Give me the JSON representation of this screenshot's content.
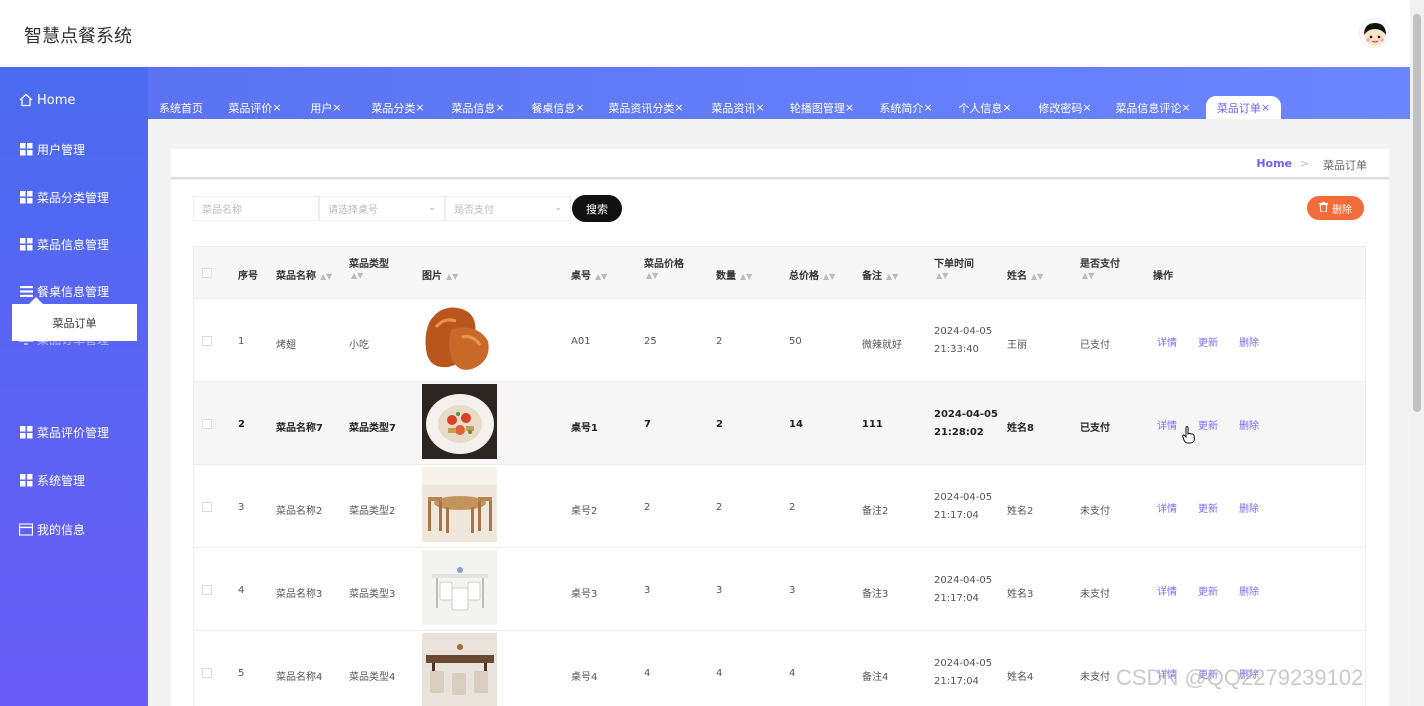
{
  "app": {
    "title": "智慧点餐系统"
  },
  "sidebar": {
    "items": [
      {
        "label": "Home",
        "icon": "home-icon"
      },
      {
        "label": "用户管理",
        "icon": "grid-icon"
      },
      {
        "label": "菜品分类管理",
        "icon": "grid-icon"
      },
      {
        "label": "菜品信息管理",
        "icon": "grid-icon"
      },
      {
        "label": "餐桌信息管理",
        "icon": "list-icon"
      },
      {
        "label": "菜品订单管理",
        "icon": "monitor-icon"
      },
      {
        "label": "菜品评价管理",
        "icon": "grid-icon"
      },
      {
        "label": "系统管理",
        "icon": "grid-icon"
      },
      {
        "label": "我的信息",
        "icon": "card-icon"
      }
    ],
    "sub_item": "菜品订单"
  },
  "tabs": [
    {
      "label": "系统首页",
      "close": ""
    },
    {
      "label": "菜品评价",
      "close": "×"
    },
    {
      "label": "用户",
      "close": "×"
    },
    {
      "label": "菜品分类",
      "close": "×"
    },
    {
      "label": "菜品信息",
      "close": "×"
    },
    {
      "label": "餐桌信息",
      "close": "×"
    },
    {
      "label": "菜品资讯分类",
      "close": "×"
    },
    {
      "label": "菜品资讯",
      "close": "×"
    },
    {
      "label": "轮播图管理",
      "close": "×"
    },
    {
      "label": "系统简介",
      "close": "×"
    },
    {
      "label": "个人信息",
      "close": "×"
    },
    {
      "label": "修改密码",
      "close": "×"
    },
    {
      "label": "菜品信息评论",
      "close": "×"
    },
    {
      "label": "菜品订单",
      "close": "×"
    }
  ],
  "breadcrumb": {
    "home": "Home",
    "sep": ">",
    "current": "菜品订单"
  },
  "search": {
    "name_placeholder": "菜品名称",
    "table_placeholder": "请选择桌号",
    "paid_placeholder": "是否支付",
    "search_label": "搜索",
    "delete_label": "删除"
  },
  "table": {
    "columns": [
      "序号",
      "菜品名称",
      "菜品类型",
      "图片",
      "桌号",
      "菜品价格",
      "数量",
      "总价格",
      "备注",
      "下单时间",
      "姓名",
      "是否支付",
      "操作"
    ],
    "rows": [
      {
        "idx": "1",
        "name": "烤翅",
        "type": "小吃",
        "table": "A01",
        "price": "25",
        "qty": "2",
        "total": "50",
        "note": "微辣就好",
        "date": "2024-04-05",
        "time": "21:33:40",
        "person": "王丽",
        "paid": "已支付"
      },
      {
        "idx": "2",
        "name": "菜品名称7",
        "type": "菜品类型7",
        "table": "桌号1",
        "price": "7",
        "qty": "2",
        "total": "14",
        "note": "111",
        "date": "2024-04-05",
        "time": "21:28:02",
        "person": "姓名8",
        "paid": "已支付"
      },
      {
        "idx": "3",
        "name": "菜品名称2",
        "type": "菜品类型2",
        "table": "桌号2",
        "price": "2",
        "qty": "2",
        "total": "2",
        "note": "备注2",
        "date": "2024-04-05",
        "time": "21:17:04",
        "person": "姓名2",
        "paid": "未支付"
      },
      {
        "idx": "4",
        "name": "菜品名称3",
        "type": "菜品类型3",
        "table": "桌号3",
        "price": "3",
        "qty": "3",
        "total": "3",
        "note": "备注3",
        "date": "2024-04-05",
        "time": "21:17:04",
        "person": "姓名3",
        "paid": "未支付"
      },
      {
        "idx": "5",
        "name": "菜品名称4",
        "type": "菜品类型4",
        "table": "桌号4",
        "price": "4",
        "qty": "4",
        "total": "4",
        "note": "备注4",
        "date": "2024-04-05",
        "time": "21:17:04",
        "person": "姓名4",
        "paid": "未支付"
      }
    ],
    "actions": {
      "detail": "详情",
      "update": "更新",
      "delete": "删除"
    }
  },
  "watermark": "CSDN @QQ2279239102",
  "colors": {
    "accent": "#6b63f6",
    "sidebar_top": "#4b6cf0",
    "sidebar_bottom": "#6a5cf7",
    "delete_btn": "#f26b3a"
  }
}
